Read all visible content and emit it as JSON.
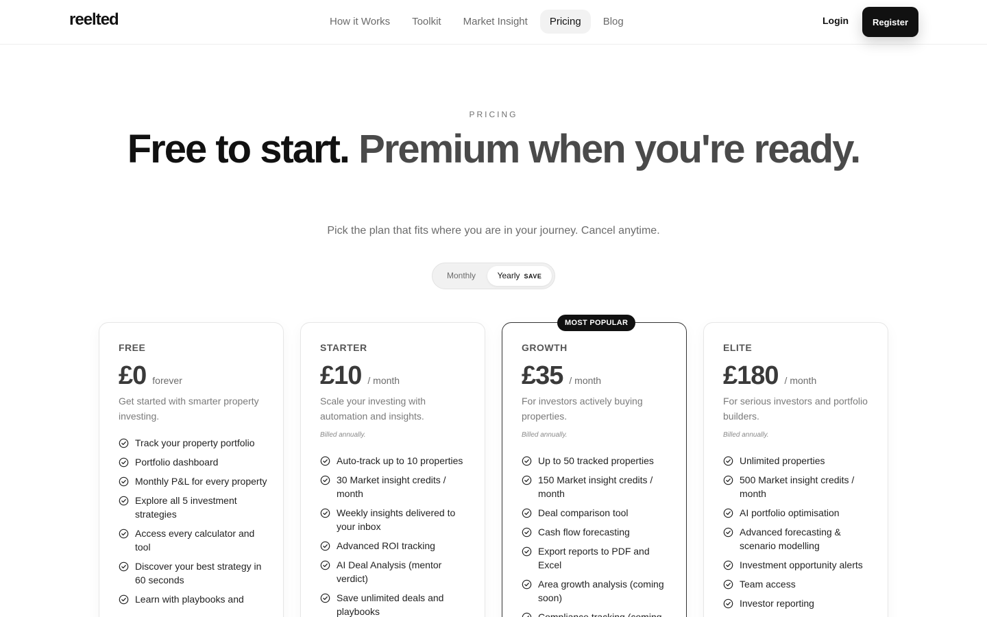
{
  "header": {
    "logo": "reelted",
    "nav": [
      {
        "label": "How it Works",
        "active": false
      },
      {
        "label": "Toolkit",
        "active": false
      },
      {
        "label": "Market Insight",
        "active": false
      },
      {
        "label": "Pricing",
        "active": true
      },
      {
        "label": "Blog",
        "active": false
      }
    ],
    "login": "Login",
    "register": "Register"
  },
  "hero": {
    "eyebrow": "PRICING",
    "headline_dark": "Free to start.",
    "headline_grey": "Premium when you're ready.",
    "subhead": "Pick the plan that fits where you are in your journey. Cancel anytime."
  },
  "billing_toggle": {
    "monthly": "Monthly",
    "yearly": "Yearly",
    "save": "SAVE",
    "selected": "Yearly"
  },
  "plans": [
    {
      "name": "FREE",
      "price": "£0",
      "period": "forever",
      "description": "Get started with smarter property investing.",
      "billed": "",
      "badge": "",
      "features": [
        "Track your property portfolio",
        "Portfolio dashboard",
        "Monthly P&L for every property",
        "Explore all 5 investment strategies",
        "Access every calculator and tool",
        "Discover your best strategy in 60 seconds",
        "Learn with playbooks and"
      ]
    },
    {
      "name": "STARTER",
      "price": "£10",
      "period": "/ month",
      "description": "Scale your investing with automation and insights.",
      "billed": "Billed annually.",
      "badge": "",
      "features": [
        "Auto-track up to 10 properties",
        "30 Market insight credits / month",
        "Weekly insights delivered to your inbox",
        "Advanced ROI tracking",
        "AI Deal Analysis (mentor verdict)",
        "Save unlimited deals and playbooks"
      ]
    },
    {
      "name": "GROWTH",
      "price": "£35",
      "period": "/ month",
      "description": "For investors actively buying properties.",
      "billed": "Billed annually.",
      "badge": "MOST POPULAR",
      "features": [
        "Up to 50 tracked properties",
        "150 Market insight credits / month",
        "Deal comparison tool",
        "Cash flow forecasting",
        "Export reports to PDF and Excel",
        "Area growth analysis (coming soon)",
        "Compliance tracking (coming"
      ]
    },
    {
      "name": "ELITE",
      "price": "£180",
      "period": "/ month",
      "description": "For serious investors and portfolio builders.",
      "billed": "Billed annually.",
      "badge": "",
      "features": [
        "Unlimited properties",
        "500 Market insight credits / month",
        "AI portfolio optimisation",
        "Advanced forecasting & scenario modelling",
        "Investment opportunity alerts",
        "Team access",
        "Investor reporting"
      ]
    }
  ],
  "colors": {
    "primary": "#111111",
    "muted_text": "#6b6b6b",
    "border": "#e6e6e6"
  }
}
